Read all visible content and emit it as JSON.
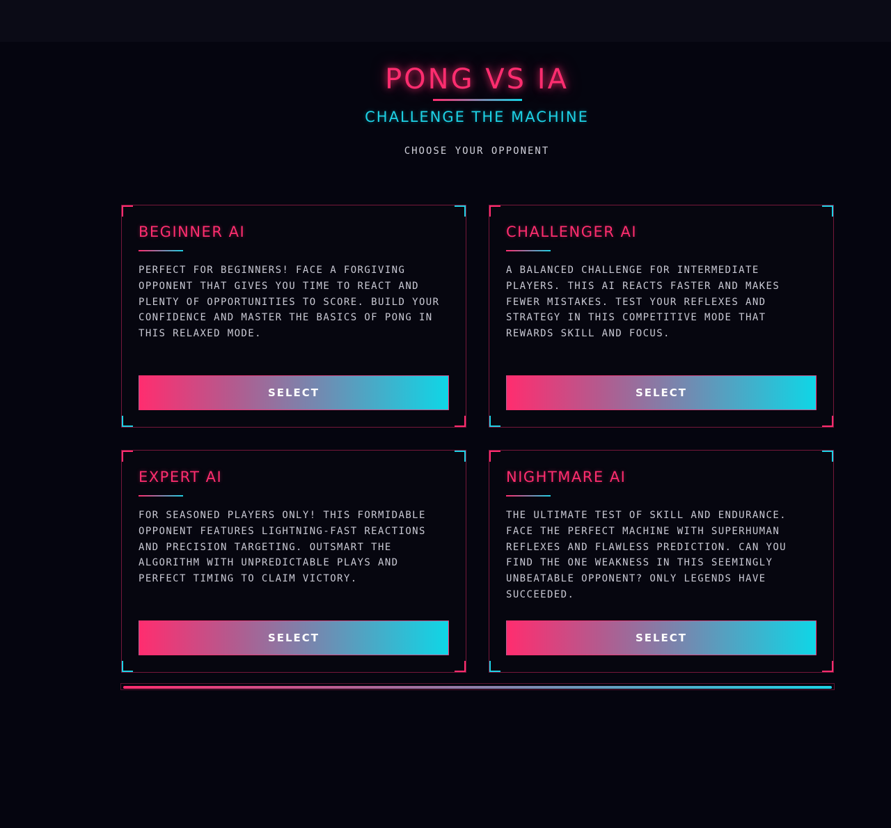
{
  "header": {
    "title": "PONG VS IA",
    "subtitle": "CHALLENGE THE MACHINE",
    "prompt": "CHOOSE YOUR OPPONENT"
  },
  "cards": [
    {
      "title": "BEGINNER AI",
      "description": "PERFECT FOR BEGINNERS! FACE A FORGIVING OPPONENT THAT GIVES YOU TIME TO REACT AND PLENTY OF OPPORTUNITIES TO SCORE. BUILD YOUR CONFIDENCE AND MASTER THE BASICS OF PONG IN THIS RELAXED MODE.",
      "button": "SELECT"
    },
    {
      "title": "CHALLENGER AI",
      "description": "A BALANCED CHALLENGE FOR INTERMEDIATE PLAYERS. THIS AI REACTS FASTER AND MAKES FEWER MISTAKES. TEST YOUR REFLEXES AND STRATEGY IN THIS COMPETITIVE MODE THAT REWARDS SKILL AND FOCUS.",
      "button": "SELECT"
    },
    {
      "title": "EXPERT AI",
      "description": "FOR SEASONED PLAYERS ONLY! THIS FORMIDABLE OPPONENT FEATURES LIGHTNING-FAST REACTIONS AND PRECISION TARGETING. OUTSMART THE ALGORITHM WITH UNPREDICTABLE PLAYS AND PERFECT TIMING TO CLAIM VICTORY.",
      "button": "SELECT"
    },
    {
      "title": "NIGHTMARE AI",
      "description": "THE ULTIMATE TEST OF SKILL AND ENDURANCE. FACE THE PERFECT MACHINE WITH SUPERHUMAN REFLEXES AND FLAWLESS PREDICTION. CAN YOU FIND THE ONE WEAKNESS IN THIS SEEMINGLY UNBEATABLE OPPONENT? ONLY LEGENDS HAVE SUCCEEDED.",
      "button": "SELECT"
    }
  ],
  "progress": {
    "fraction": 1.0
  },
  "colors": {
    "accent_pink": "#ff2d6f",
    "accent_cyan": "#0fd6e6",
    "background": "#05050f"
  }
}
